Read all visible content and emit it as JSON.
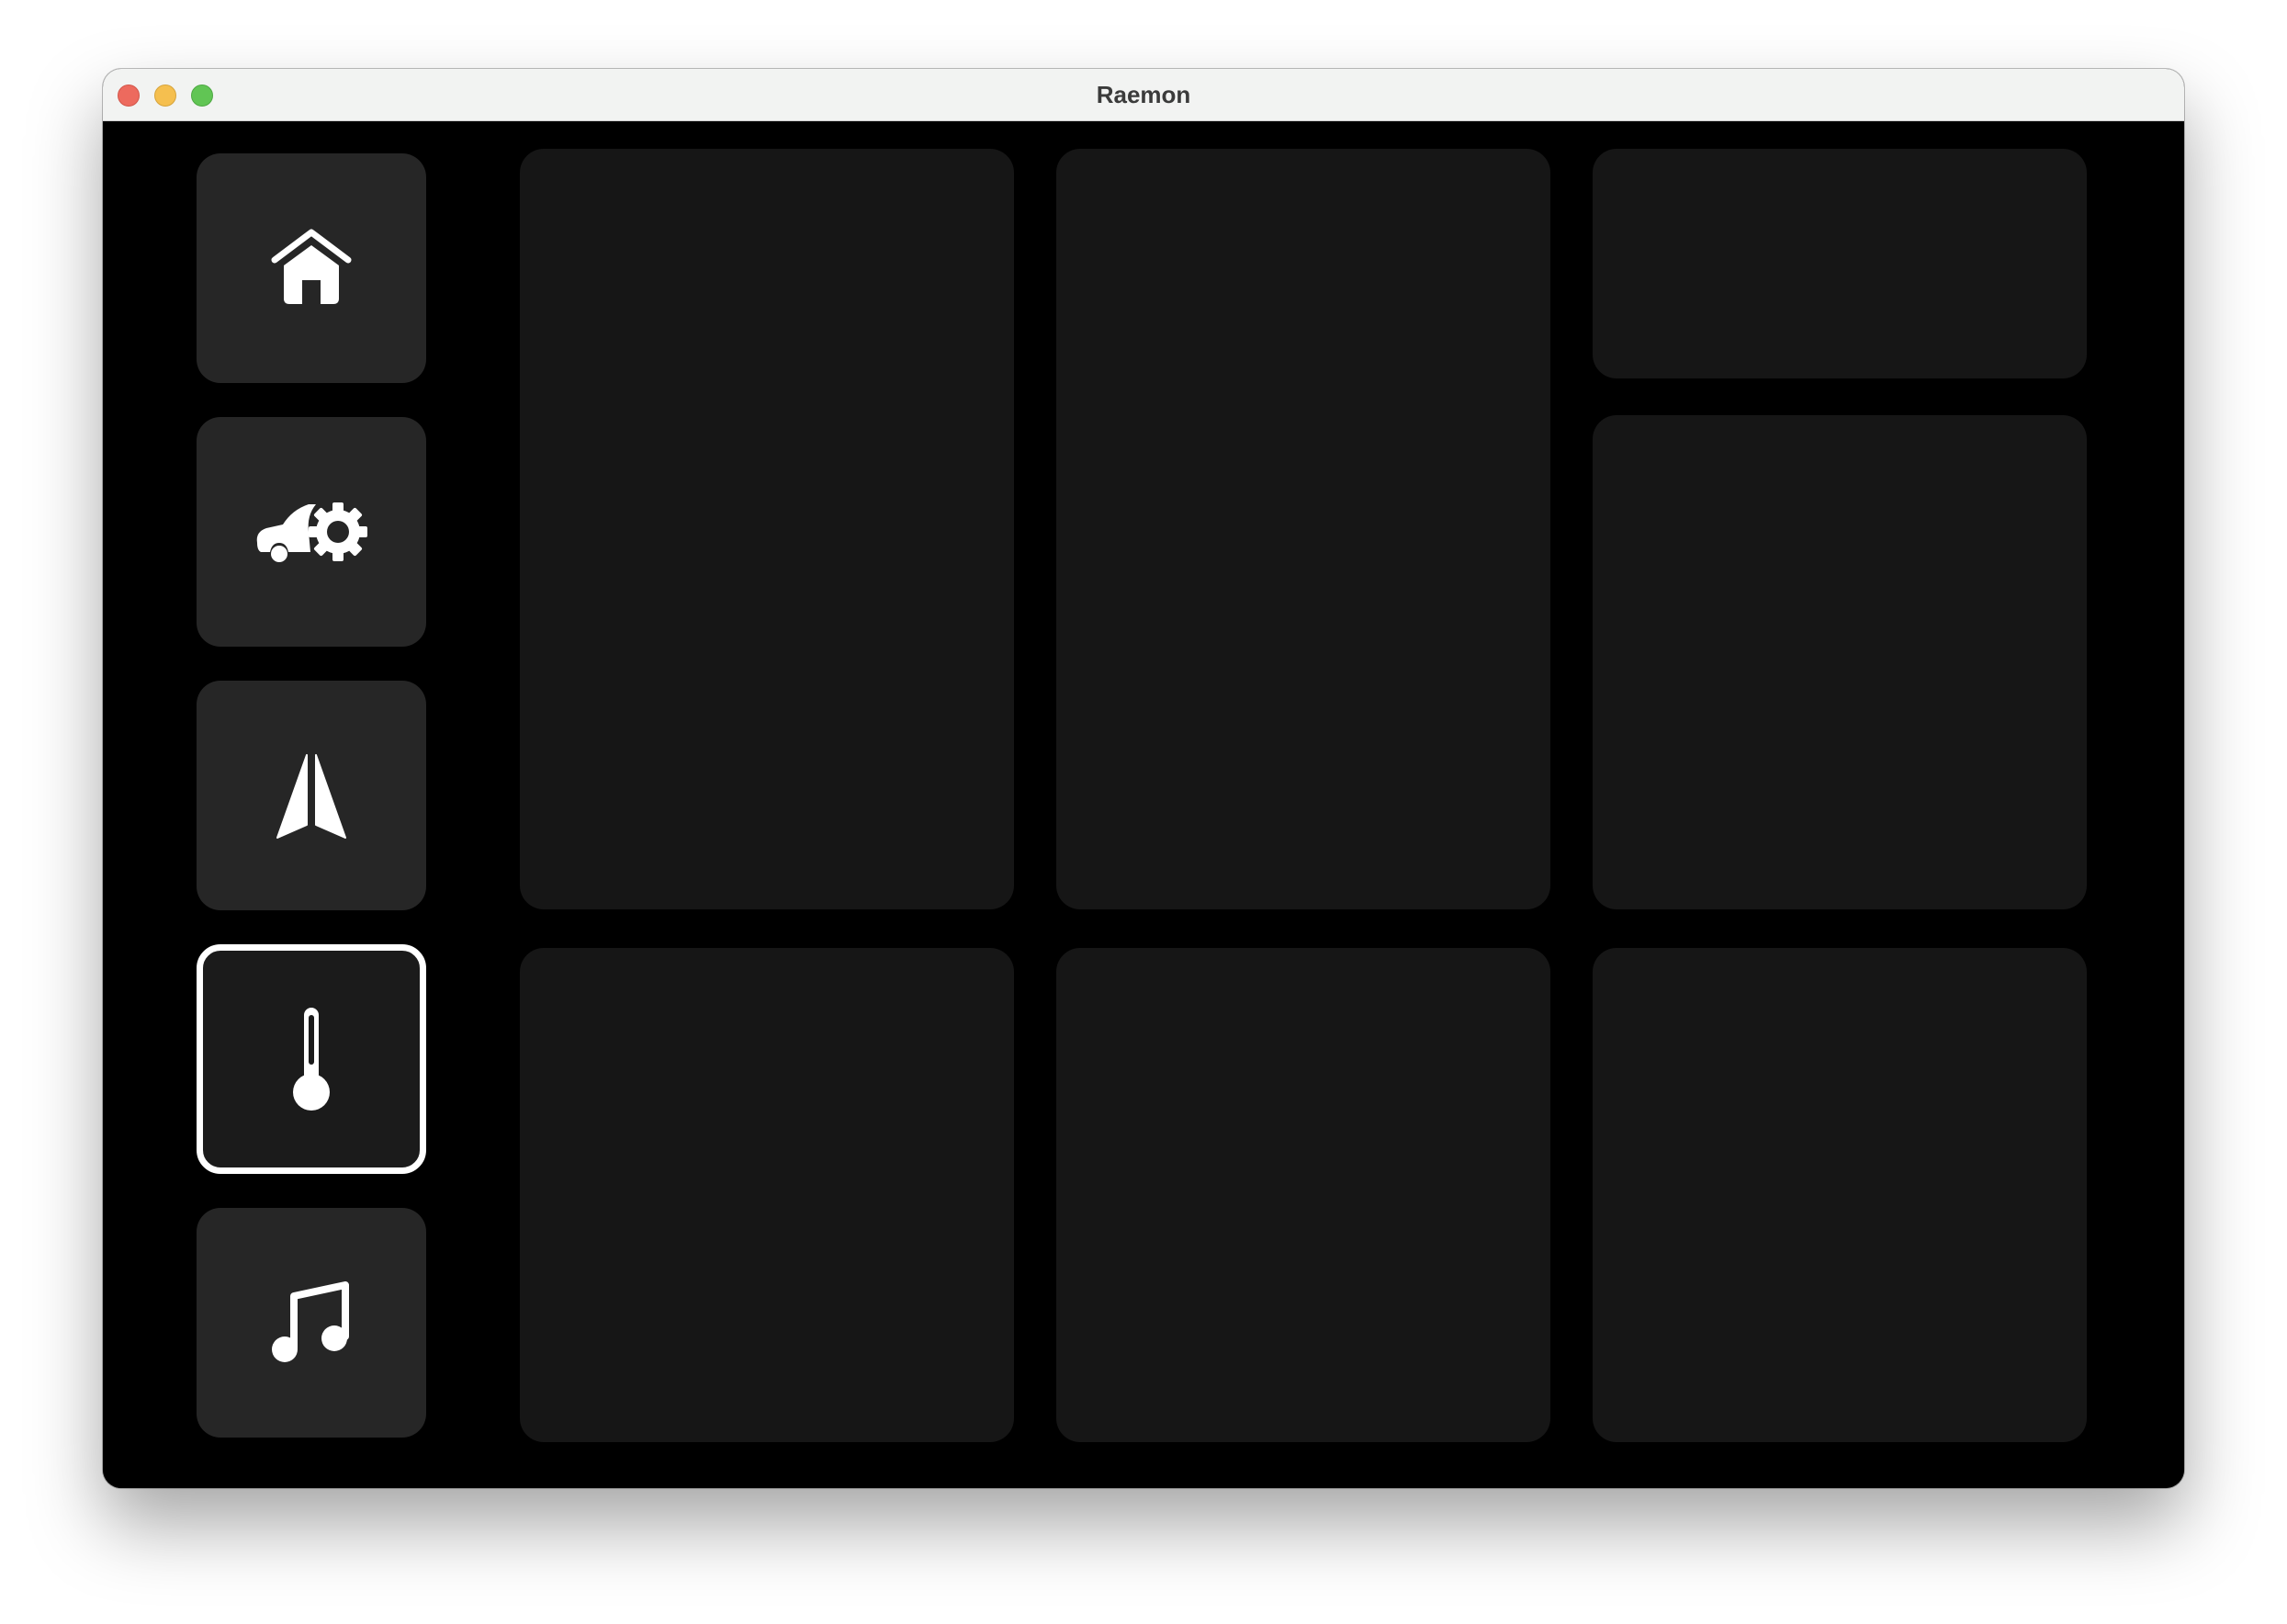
{
  "window": {
    "title": "Raemon"
  },
  "sidebar": {
    "items": [
      {
        "icon": "home-icon",
        "selected": false
      },
      {
        "icon": "car-gear-icon",
        "selected": false
      },
      {
        "icon": "navigation-arrow-icon",
        "selected": false
      },
      {
        "icon": "thermometer-icon",
        "selected": true
      },
      {
        "icon": "music-note-icon",
        "selected": false
      }
    ]
  },
  "colors": {
    "background": "#000000",
    "nav_button": "#262626",
    "tile": "#161616",
    "icon": "#ffffff",
    "selected_border": "#ffffff"
  }
}
